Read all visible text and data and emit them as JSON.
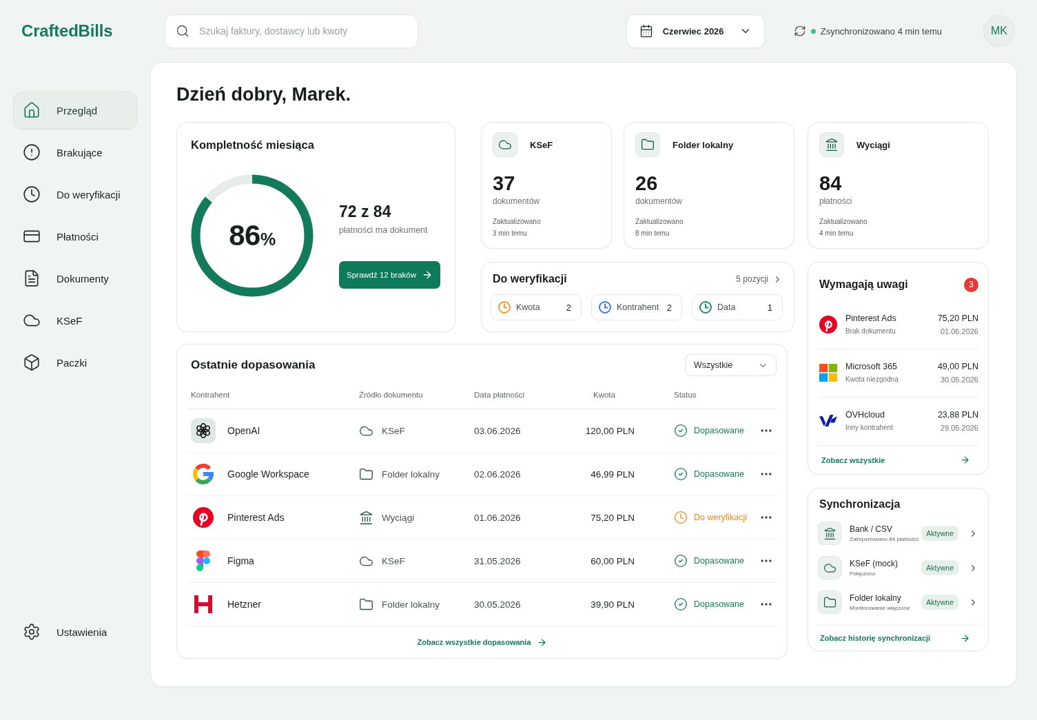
{
  "logo": "CraftedBills",
  "search": {
    "placeholder": "Szukaj faktury, dostawcy lub kwoty"
  },
  "month_picker": {
    "value": "Czerwiec 2026"
  },
  "sync_status": {
    "text": "Zsynchronizowano 4 min temu",
    "synced": true
  },
  "user": {
    "initials": "MK"
  },
  "sidebar": {
    "items": [
      {
        "label": "Przegląd",
        "kind": "home",
        "selected": true
      },
      {
        "label": "Brakujące",
        "kind": "alert",
        "selected": false
      },
      {
        "label": "Do weryfikacji",
        "kind": "clock",
        "selected": false
      },
      {
        "label": "Płatności",
        "kind": "card",
        "selected": false
      },
      {
        "label": "Dokumenty",
        "kind": "file",
        "selected": false
      },
      {
        "label": "KSeF",
        "kind": "cloud",
        "selected": false
      },
      {
        "label": "Paczki",
        "kind": "box",
        "selected": false
      }
    ],
    "footer_items": [
      {
        "label": "Ustawienia",
        "kind": "settings",
        "selected": false
      }
    ]
  },
  "greeting": "Dzień dobry, Marek.",
  "completeness": {
    "title": "Kompletność miesiąca",
    "level": 0.86,
    "value": "86",
    "unit": "%",
    "count": "72 z 84",
    "caption": "płatności ma dokument",
    "button": "Sprawdź 12 braków"
  },
  "sources": [
    {
      "kind": "cloud",
      "title": "KSeF",
      "count": "37",
      "unit": "dokumentów",
      "updated_label": "Zaktualizowano",
      "updated_time": "3 min temu"
    },
    {
      "kind": "folder",
      "title": "Folder lokalny",
      "count": "26",
      "unit": "dokumentów",
      "updated_label": "Zaktualizowano",
      "updated_time": "8 min temu"
    },
    {
      "kind": "bank",
      "title": "Wyciągi",
      "count": "84",
      "unit": "płatności",
      "updated_label": "Zaktualizowano",
      "updated_time": "4 min temu"
    }
  ],
  "review": {
    "title": "Do weryfikacji",
    "link": "5 pozycji",
    "chips": [
      {
        "label": "Kwota",
        "count": "2",
        "color": "#f29a2e"
      },
      {
        "label": "Kontrahent",
        "count": "2",
        "color": "#3b7ddd"
      },
      {
        "label": "Data",
        "count": "1",
        "color": "#1f8a64"
      }
    ]
  },
  "matches": {
    "title": "Ostatnie dopasowania",
    "filter": "Wszystkie",
    "columns": [
      "Kontrahent",
      "Źródło dokumentu",
      "Data płatności",
      "Kwota",
      "Status"
    ],
    "rows": [
      {
        "kind": "openai",
        "name": "OpenAI",
        "source": {
          "kind": "cloud",
          "label": "KSeF"
        },
        "date": "03.06.2026",
        "amount": "120,00 PLN",
        "status": {
          "kind": "matched",
          "label": "Dopasowane"
        }
      },
      {
        "kind": "google",
        "name": "Google Workspace",
        "source": {
          "kind": "folder",
          "label": "Folder lokalny"
        },
        "date": "02.06.2026",
        "amount": "46,99 PLN",
        "status": {
          "kind": "matched",
          "label": "Dopasowane"
        }
      },
      {
        "kind": "pinterest",
        "name": "Pinterest Ads",
        "source": {
          "kind": "bank",
          "label": "Wyciągi"
        },
        "date": "01.06.2026",
        "amount": "75,20 PLN",
        "status": {
          "kind": "review",
          "label": "Do weryfikacji"
        }
      },
      {
        "kind": "figma",
        "name": "Figma",
        "source": {
          "kind": "cloud",
          "label": "KSeF"
        },
        "date": "31.05.2026",
        "amount": "60,00 PLN",
        "status": {
          "kind": "matched",
          "label": "Dopasowane"
        }
      },
      {
        "kind": "hetzner",
        "name": "Hetzner",
        "source": {
          "kind": "folder",
          "label": "Folder lokalny"
        },
        "date": "30.05.2026",
        "amount": "39,90 PLN",
        "status": {
          "kind": "matched",
          "label": "Dopasowane"
        }
      }
    ],
    "footer_link": "Zobacz wszystkie dopasowania"
  },
  "attention": {
    "title": "Wymagają uwagi",
    "badge": "3",
    "items": [
      {
        "kind": "pinterest",
        "name": "Pinterest Ads",
        "reason": "Brak dokumentu",
        "amount": "75,20 PLN",
        "date": "01.06.2026"
      },
      {
        "kind": "microsoft",
        "name": "Microsoft 365",
        "reason": "Kwota niezgodna",
        "amount": "49,00 PLN",
        "date": "30.05.2026"
      },
      {
        "kind": "ovh",
        "name": "OVHcloud",
        "reason": "Inny kontrahent",
        "amount": "23,88 PLN",
        "date": "29.05.2026"
      }
    ],
    "link": "Zobacz wszystkie"
  },
  "sync": {
    "title": "Synchronizacja",
    "items": [
      {
        "kind": "bank",
        "name": "Bank / CSV",
        "detail": "Zaimportowano 84 płatności",
        "status": "Aktywne"
      },
      {
        "kind": "cloud",
        "name": "KSeF (mock)",
        "detail": "Połączono",
        "status": "Aktywne"
      },
      {
        "kind": "folder",
        "name": "Folder lokalny",
        "detail": "Monitorowanie włączone",
        "status": "Aktywne"
      }
    ],
    "link": "Zobacz historię synchronizacji"
  }
}
